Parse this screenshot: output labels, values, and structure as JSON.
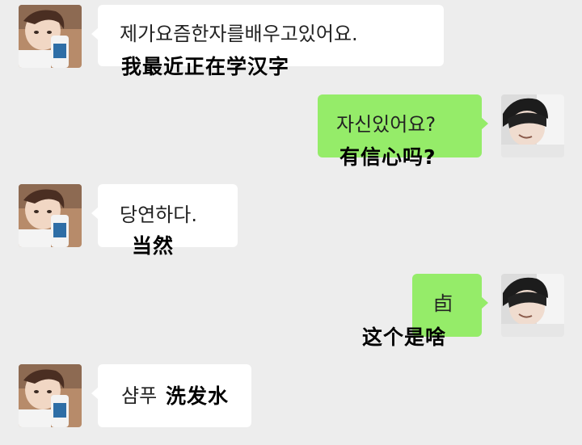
{
  "messages": [
    {
      "side": "left",
      "text": "제가요즘한자를배우고있어요.",
      "annotation": "我最近正在学汉字"
    },
    {
      "side": "right",
      "text": "자신있어요?",
      "annotation": "有信心吗?"
    },
    {
      "side": "left",
      "text": "당연하다.",
      "annotation": "当然"
    },
    {
      "side": "right",
      "text": "卣",
      "annotation": "这个是啥"
    },
    {
      "side": "left",
      "text": "샴푸",
      "annotation": "洗发水"
    }
  ],
  "colors": {
    "background": "#ededed",
    "incoming_bubble": "#ffffff",
    "outgoing_bubble": "#95ec69"
  },
  "icons": {
    "left_avatar": "girl-avatar",
    "right_avatar": "boy-avatar"
  }
}
